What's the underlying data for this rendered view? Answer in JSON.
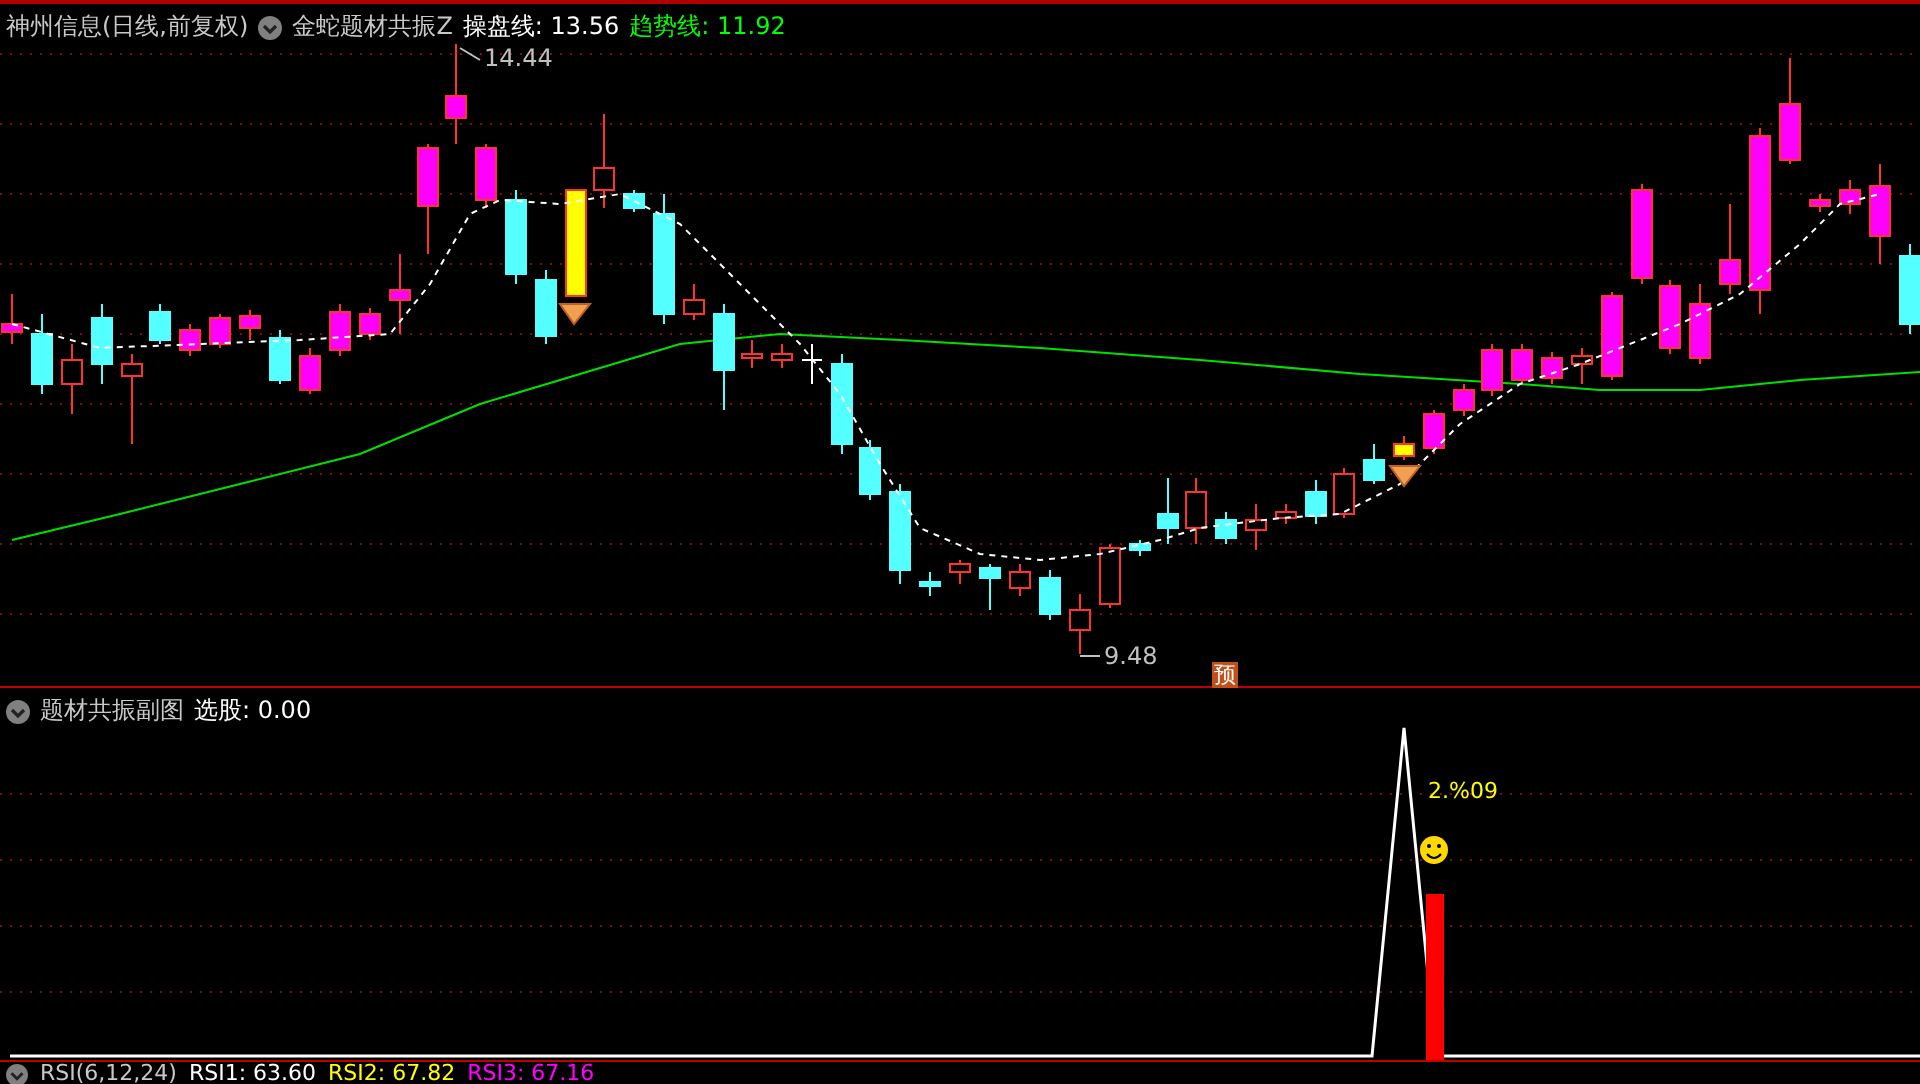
{
  "main_panel": {
    "stock": "神州信息(日线,前复权)",
    "indicator": "金蛇题材共振Z",
    "lines": [
      {
        "text": "操盘线: 13.56",
        "color": "#ffffff"
      },
      {
        "text": "趋势线: 11.92",
        "color": "#00ff00"
      }
    ],
    "high_label": "14.44",
    "low_label": "9.48",
    "signal_badge": "预"
  },
  "sub_panel": {
    "title": "题材共振副图",
    "field": "选股: 0.00",
    "value_label": "2.%09"
  },
  "bottom_panel": {
    "title": "RSI(6,12,24)",
    "lines": [
      {
        "text": "RSI1: 63.60",
        "color": "#ffffff"
      },
      {
        "text": "RSI2: 67.82",
        "color": "#ffff00"
      },
      {
        "text": "RSI3: 67.16",
        "color": "#ff00ff"
      }
    ]
  }
}
